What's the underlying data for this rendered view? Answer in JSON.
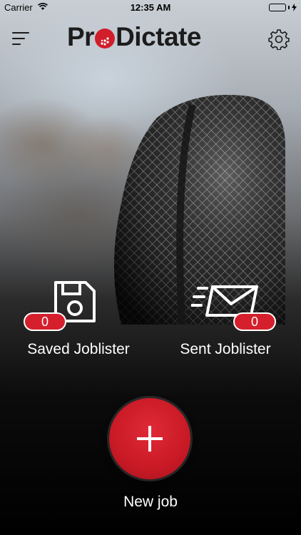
{
  "status_bar": {
    "carrier": "Carrier",
    "time": "12:35 AM"
  },
  "header": {
    "logo_left": "Pr",
    "logo_right": "Dictate",
    "menu_icon": "hamburger-menu-icon",
    "settings_icon": "gear-icon"
  },
  "saved": {
    "label": "Saved Joblister",
    "count": "0",
    "icon": "floppy-disk-icon"
  },
  "sent": {
    "label": "Sent Joblister",
    "count": "0",
    "icon": "envelope-icon"
  },
  "new_job": {
    "label": "New job",
    "icon": "plus-icon"
  },
  "colors": {
    "accent": "#d01e2a",
    "badge": "#d51f2c",
    "logo_text": "#1c1c1c"
  }
}
